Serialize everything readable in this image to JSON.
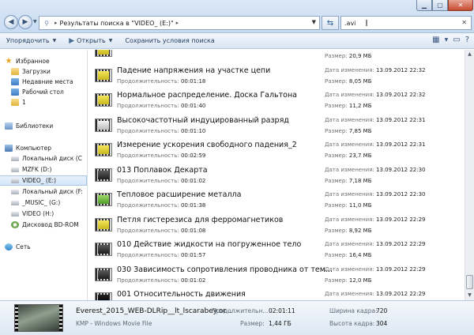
{
  "window": {
    "min_icon": "minimize-icon",
    "max_icon": "maximize-icon",
    "close_icon": "close-icon"
  },
  "address": {
    "path": "Результаты поиска в \"VIDEO_ (E:)\"",
    "separator": "▸"
  },
  "search": {
    "value": ".avi"
  },
  "toolbar": {
    "organize": "Упорядочить",
    "open": "Открыть",
    "save_search": "Сохранить условия поиска"
  },
  "nav": {
    "favorites": "Избранное",
    "downloads": "Загрузки",
    "recent": "Недавние места",
    "desktop": "Рабочий стол",
    "folder1": "1",
    "libraries": "Библиотеки",
    "computer": "Компьютер",
    "drive_c": "Локальный диск (C",
    "drive_d": "MZFK (D:)",
    "drive_e": "VIDEO_ (E:)",
    "drive_f": "Локальный диск (F:",
    "drive_g": "_MUSIC_ (G:)",
    "drive_h": "VIDEO (H:)",
    "drive_bd": "Дисковод BD-ROM",
    "network": "Сеть"
  },
  "labels": {
    "duration": "Продолжительность:",
    "modified": "Дата изменения:",
    "size": "Размер:"
  },
  "files": [
    {
      "name": "",
      "duration": "",
      "modified": "",
      "size": "20,9 МБ",
      "thumb": "yellow"
    },
    {
      "name": "Падение напряжения на участке цепи",
      "duration": "00:01:18",
      "modified": "13.09.2012 22:32",
      "size": "8,05 МБ",
      "thumb": "yellow"
    },
    {
      "name": "Нормальное распределение. Доска Гальтона",
      "duration": "00:01:40",
      "modified": "13.09.2012 22:32",
      "size": "11,2 МБ",
      "thumb": "yellow"
    },
    {
      "name": "Высокочастотный индуцированный разряд",
      "duration": "00:01:10",
      "modified": "13.09.2012 22:31",
      "size": "7,85 МБ",
      "thumb": "gray"
    },
    {
      "name": "Измерение ускорения свободного падения_2",
      "duration": "00:02:59",
      "modified": "13.09.2012 22:31",
      "size": "23,7 МБ",
      "thumb": "yellow"
    },
    {
      "name": "013 Поплавок Декарта",
      "duration": "00:01:02",
      "modified": "13.09.2012 22:30",
      "size": "7,18 МБ",
      "thumb": "dark"
    },
    {
      "name": "Тепловое расширение металла",
      "duration": "00:01:38",
      "modified": "13.09.2012 22:30",
      "size": "11,0 МБ",
      "thumb": "green"
    },
    {
      "name": "Петля гистерезиса для ферромагнетиков",
      "duration": "00:01:08",
      "modified": "13.09.2012 22:29",
      "size": "8,92 МБ",
      "thumb": "yellow"
    },
    {
      "name": "010 Действие жидкости на погруженное тело",
      "duration": "00:01:57",
      "modified": "13.09.2012 22:29",
      "size": "16,4 МБ",
      "thumb": "dark"
    },
    {
      "name": "030 Зависимость сопротивления проводника от тем...",
      "duration": "00:01:02",
      "modified": "13.09.2012 22:29",
      "size": "12,0 МБ",
      "thumb": "dark"
    },
    {
      "name": "001 Относительность движения",
      "duration": "00:01:49",
      "modified": "13.09.2012 22:29",
      "size": "10,5 МБ",
      "thumb": "black"
    }
  ],
  "details": {
    "title": "Everest_2015_WEB-DLRip__lt_lscarabey.or...",
    "type": "KMP - Windows Movie File",
    "duration_label": "Продолжительн...",
    "duration": "02:01:11",
    "size_label": "Размер:",
    "size": "1,44 ГБ",
    "width_label": "Ширина кадра:",
    "width": "720",
    "height_label": "Высота кадра:",
    "height": "304"
  }
}
